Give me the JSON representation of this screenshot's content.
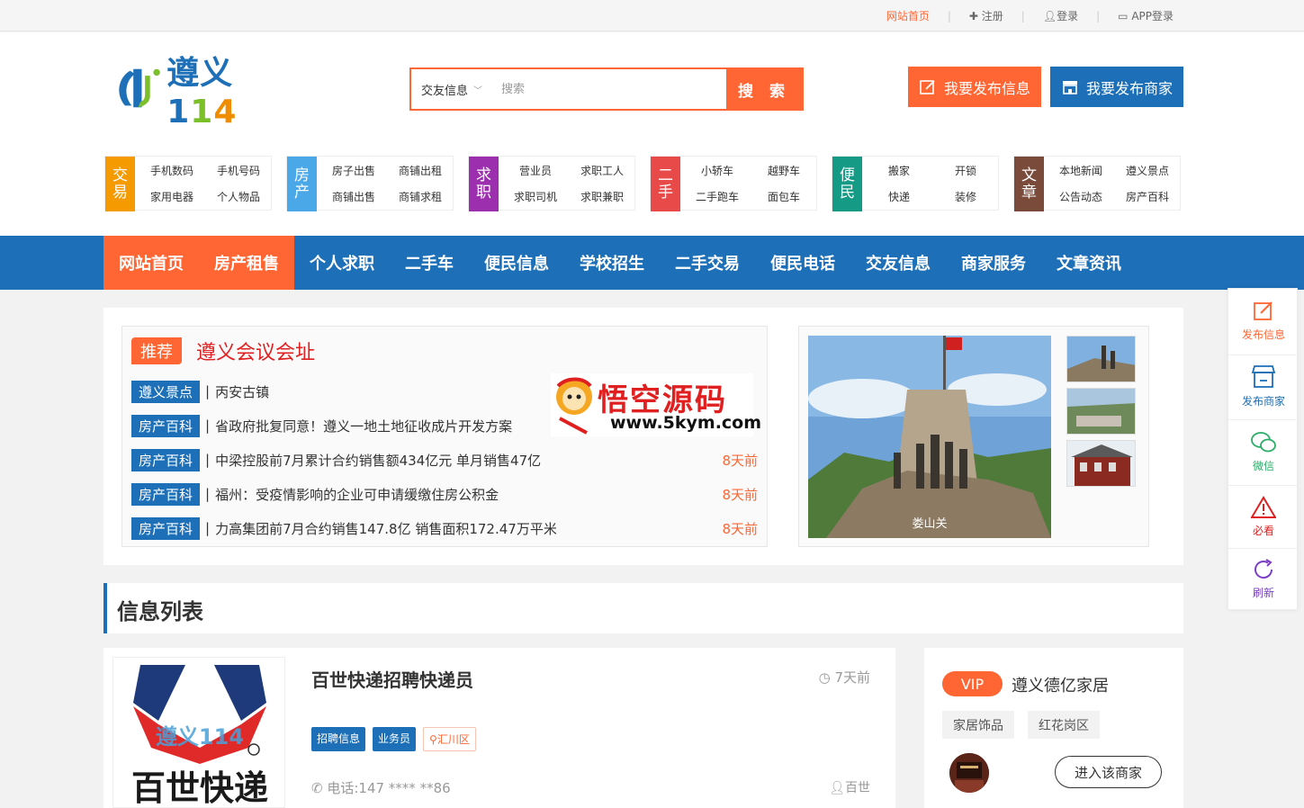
{
  "topbar": {
    "home": "网站首页",
    "register": "注册",
    "login": "登录",
    "app_login": "APP登录"
  },
  "logo": {
    "text_cn": "遵义",
    "n1": "1",
    "n2": "1",
    "n3": "4"
  },
  "search": {
    "category": "交友信息",
    "placeholder": "搜索",
    "button": "搜 索"
  },
  "publish": {
    "info": "我要发布信息",
    "merchant": "我要发布商家"
  },
  "categories": [
    {
      "tag": "交易",
      "color": "#f59a00",
      "items": [
        "手机数码",
        "手机号码",
        "家用电器",
        "个人物品"
      ]
    },
    {
      "tag": "房产",
      "color": "#4aa8e8",
      "items": [
        "房子出售",
        "商铺出租",
        "商铺出售",
        "商铺求租"
      ]
    },
    {
      "tag": "求职",
      "color": "#9b2fae",
      "items": [
        "营业员",
        "求职工人",
        "求职司机",
        "求职兼职"
      ]
    },
    {
      "tag": "二手",
      "color": "#e84a4a",
      "items": [
        "小轿车",
        "越野车",
        "二手跑车",
        "面包车"
      ]
    },
    {
      "tag": "便民",
      "color": "#159a86",
      "items": [
        "搬家",
        "开锁",
        "快递",
        "装修"
      ]
    },
    {
      "tag": "文章",
      "color": "#7a4a3a",
      "items": [
        "本地新闻",
        "遵义景点",
        "公告动态",
        "房产百科"
      ]
    }
  ],
  "nav": [
    "网站首页",
    "房产租售",
    "个人求职",
    "二手车",
    "便民信息",
    "学校招生",
    "二手交易",
    "便民电话",
    "交友信息",
    "商家服务",
    "文章资讯"
  ],
  "recommend": {
    "badge": "推荐",
    "title": "遵义会议会址",
    "rows": [
      {
        "cat": "遵义景点",
        "title": "丙安古镇",
        "time": ""
      },
      {
        "cat": "房产百科",
        "title": "省政府批复同意！遵义一地土地征收成片开发方案",
        "time": ""
      },
      {
        "cat": "房产百科",
        "title": "中梁控股前7月累计合约销售额434亿元 单月销售47亿",
        "time": "8天前"
      },
      {
        "cat": "房产百科",
        "title": "福州：受疫情影响的企业可申请缓缴住房公积金",
        "time": "8天前"
      },
      {
        "cat": "房产百科",
        "title": "力高集团前7月合约销售147.8亿 销售面积172.47万平米",
        "time": "8天前"
      }
    ]
  },
  "watermark": {
    "title": "悟空源码",
    "url": "www.5kym.com"
  },
  "gallery": {
    "caption": "娄山关"
  },
  "list": {
    "heading": "信息列表",
    "card": {
      "title": "百世快递招聘快递员",
      "time": "7天前",
      "tags": [
        "招聘信息",
        "业务员"
      ],
      "location": "汇川区",
      "phone": "电话:147 **** **86",
      "author": "百世",
      "thumb_text": "百世快递"
    }
  },
  "vip": {
    "badge": "VIP",
    "name": "遵义德亿家居",
    "tags": [
      "家居饰品",
      "红花岗区"
    ],
    "enter": "进入该商家"
  },
  "floatbar": [
    {
      "label": "发布信息",
      "icon": "edit-icon",
      "color": "#ff6633"
    },
    {
      "label": "发布商家",
      "icon": "store-icon",
      "color": "#1d6fb8"
    },
    {
      "label": "微信",
      "icon": "wechat-icon",
      "color": "#2aae67"
    },
    {
      "label": "必看",
      "icon": "warning-icon",
      "color": "#e02020"
    },
    {
      "label": "刷新",
      "icon": "refresh-icon",
      "color": "#7b3fc8"
    }
  ]
}
